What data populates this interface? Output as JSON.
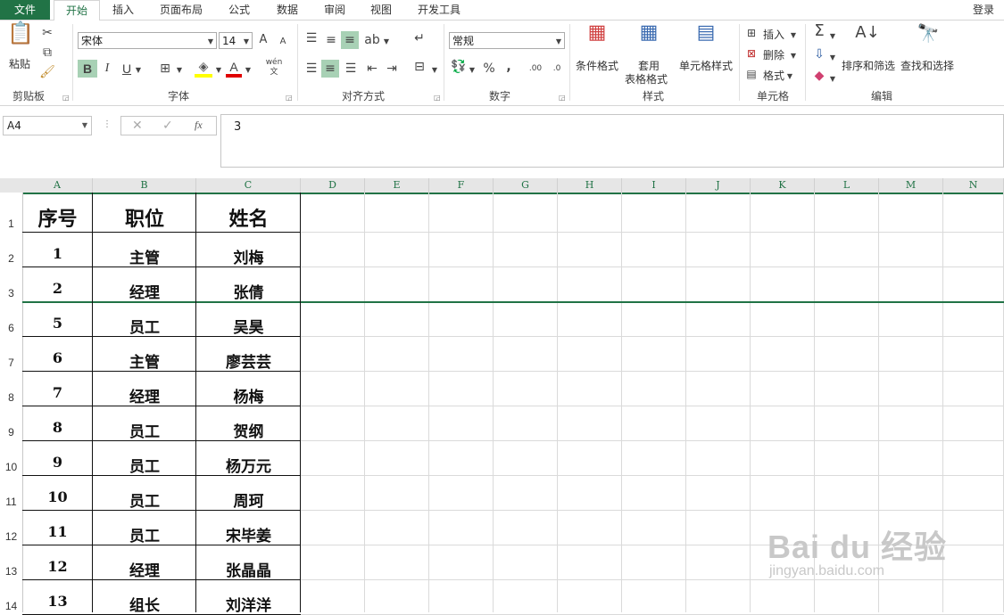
{
  "ribbon_tabs": [
    "文件",
    "开始",
    "插入",
    "页面布局",
    "公式",
    "数据",
    "审阅",
    "视图",
    "开发工具"
  ],
  "login": "登录",
  "clipboard": {
    "paste": "粘贴",
    "label": "剪贴板"
  },
  "font": {
    "name": "宋体",
    "size": "14",
    "bold": "B",
    "italic": "I",
    "underline": "U",
    "label": "字体",
    "grow": "A",
    "shrink": "A",
    "wen": "wén"
  },
  "alignment": {
    "label": "对齐方式"
  },
  "number": {
    "format": "常规",
    "percent": "%",
    "comma": ",",
    "label": "数字",
    "inc": ".00",
    "dec": ".0"
  },
  "styles": {
    "conditional": "条件格式",
    "table_line1": "套用",
    "table_line2": "表格格式",
    "cell_styles": "单元格样式",
    "label": "样式"
  },
  "cells": {
    "insert": "插入",
    "delete": "删除",
    "format": "格式",
    "label": "单元格"
  },
  "editing": {
    "sort": "排序和筛选",
    "find": "查找和选择",
    "label": "编辑"
  },
  "formula_bar": {
    "name_box": "A4",
    "fx": "fx",
    "content": "3"
  },
  "columns": [
    "A",
    "B",
    "C",
    "D",
    "E",
    "F",
    "G",
    "H",
    "I",
    "J",
    "K",
    "L",
    "M",
    "N"
  ],
  "row_numbers": [
    "1",
    "2",
    "3",
    "6",
    "7",
    "8",
    "9",
    "10",
    "11",
    "12",
    "13",
    "14"
  ],
  "table": {
    "header": [
      "序号",
      "职位",
      "姓名"
    ],
    "rows": [
      [
        "1",
        "主管",
        "刘梅"
      ],
      [
        "2",
        "经理",
        "张倩"
      ],
      [
        "5",
        "员工",
        "吴昊"
      ],
      [
        "6",
        "主管",
        "廖芸芸"
      ],
      [
        "7",
        "经理",
        "杨梅"
      ],
      [
        "8",
        "员工",
        "贺纲"
      ],
      [
        "9",
        "员工",
        "杨万元"
      ],
      [
        "10",
        "员工",
        "周珂"
      ],
      [
        "11",
        "员工",
        "宋毕姜"
      ],
      [
        "12",
        "经理",
        "张晶晶"
      ],
      [
        "13",
        "组长",
        "刘洋洋"
      ]
    ]
  },
  "watermark": {
    "main": "Bai du 经验",
    "sub": "jingyan.baidu.com"
  },
  "accent_color": "#217346"
}
